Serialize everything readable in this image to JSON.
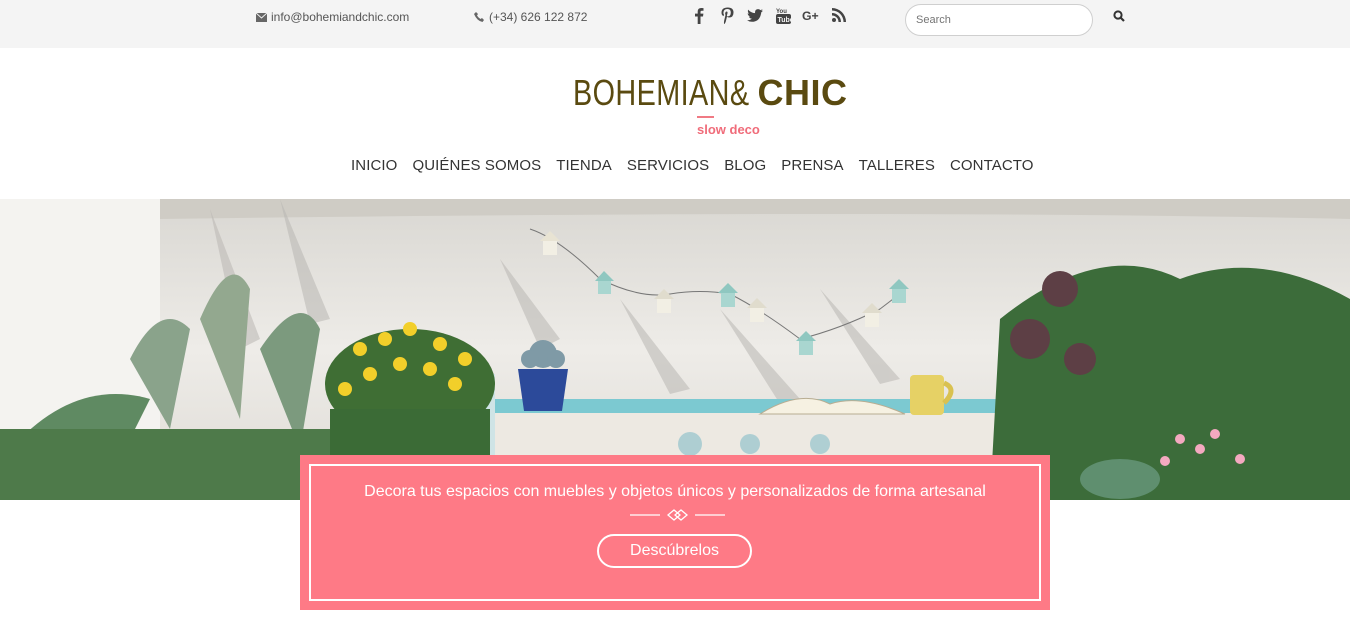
{
  "topbar": {
    "email": "info@bohemiandchic.com",
    "phone": "(+34) 626 122 872",
    "social": [
      "facebook-icon",
      "pinterest-icon",
      "twitter-icon",
      "youtube-icon",
      "google-plus-icon",
      "rss-icon"
    ],
    "search_placeholder": "Search"
  },
  "logo": {
    "brand_part1": "BOHEMIAN&",
    "brand_part2": "CHIC",
    "tagline": "slow deco"
  },
  "nav": [
    "INICIO",
    "QUIÉNES SOMOS",
    "TIENDA",
    "SERVICIOS",
    "BLOG",
    "PRENSA",
    "TALLERES",
    "CONTACTO"
  ],
  "banner": {
    "text": "Decora tus espacios con muebles y objetos únicos y personalizados de forma artesanal",
    "cta": "Descúbrelos"
  },
  "colors": {
    "accent": "#fe7a86",
    "brand": "#5a4a10",
    "topbar_bg": "#f4f4f4"
  }
}
